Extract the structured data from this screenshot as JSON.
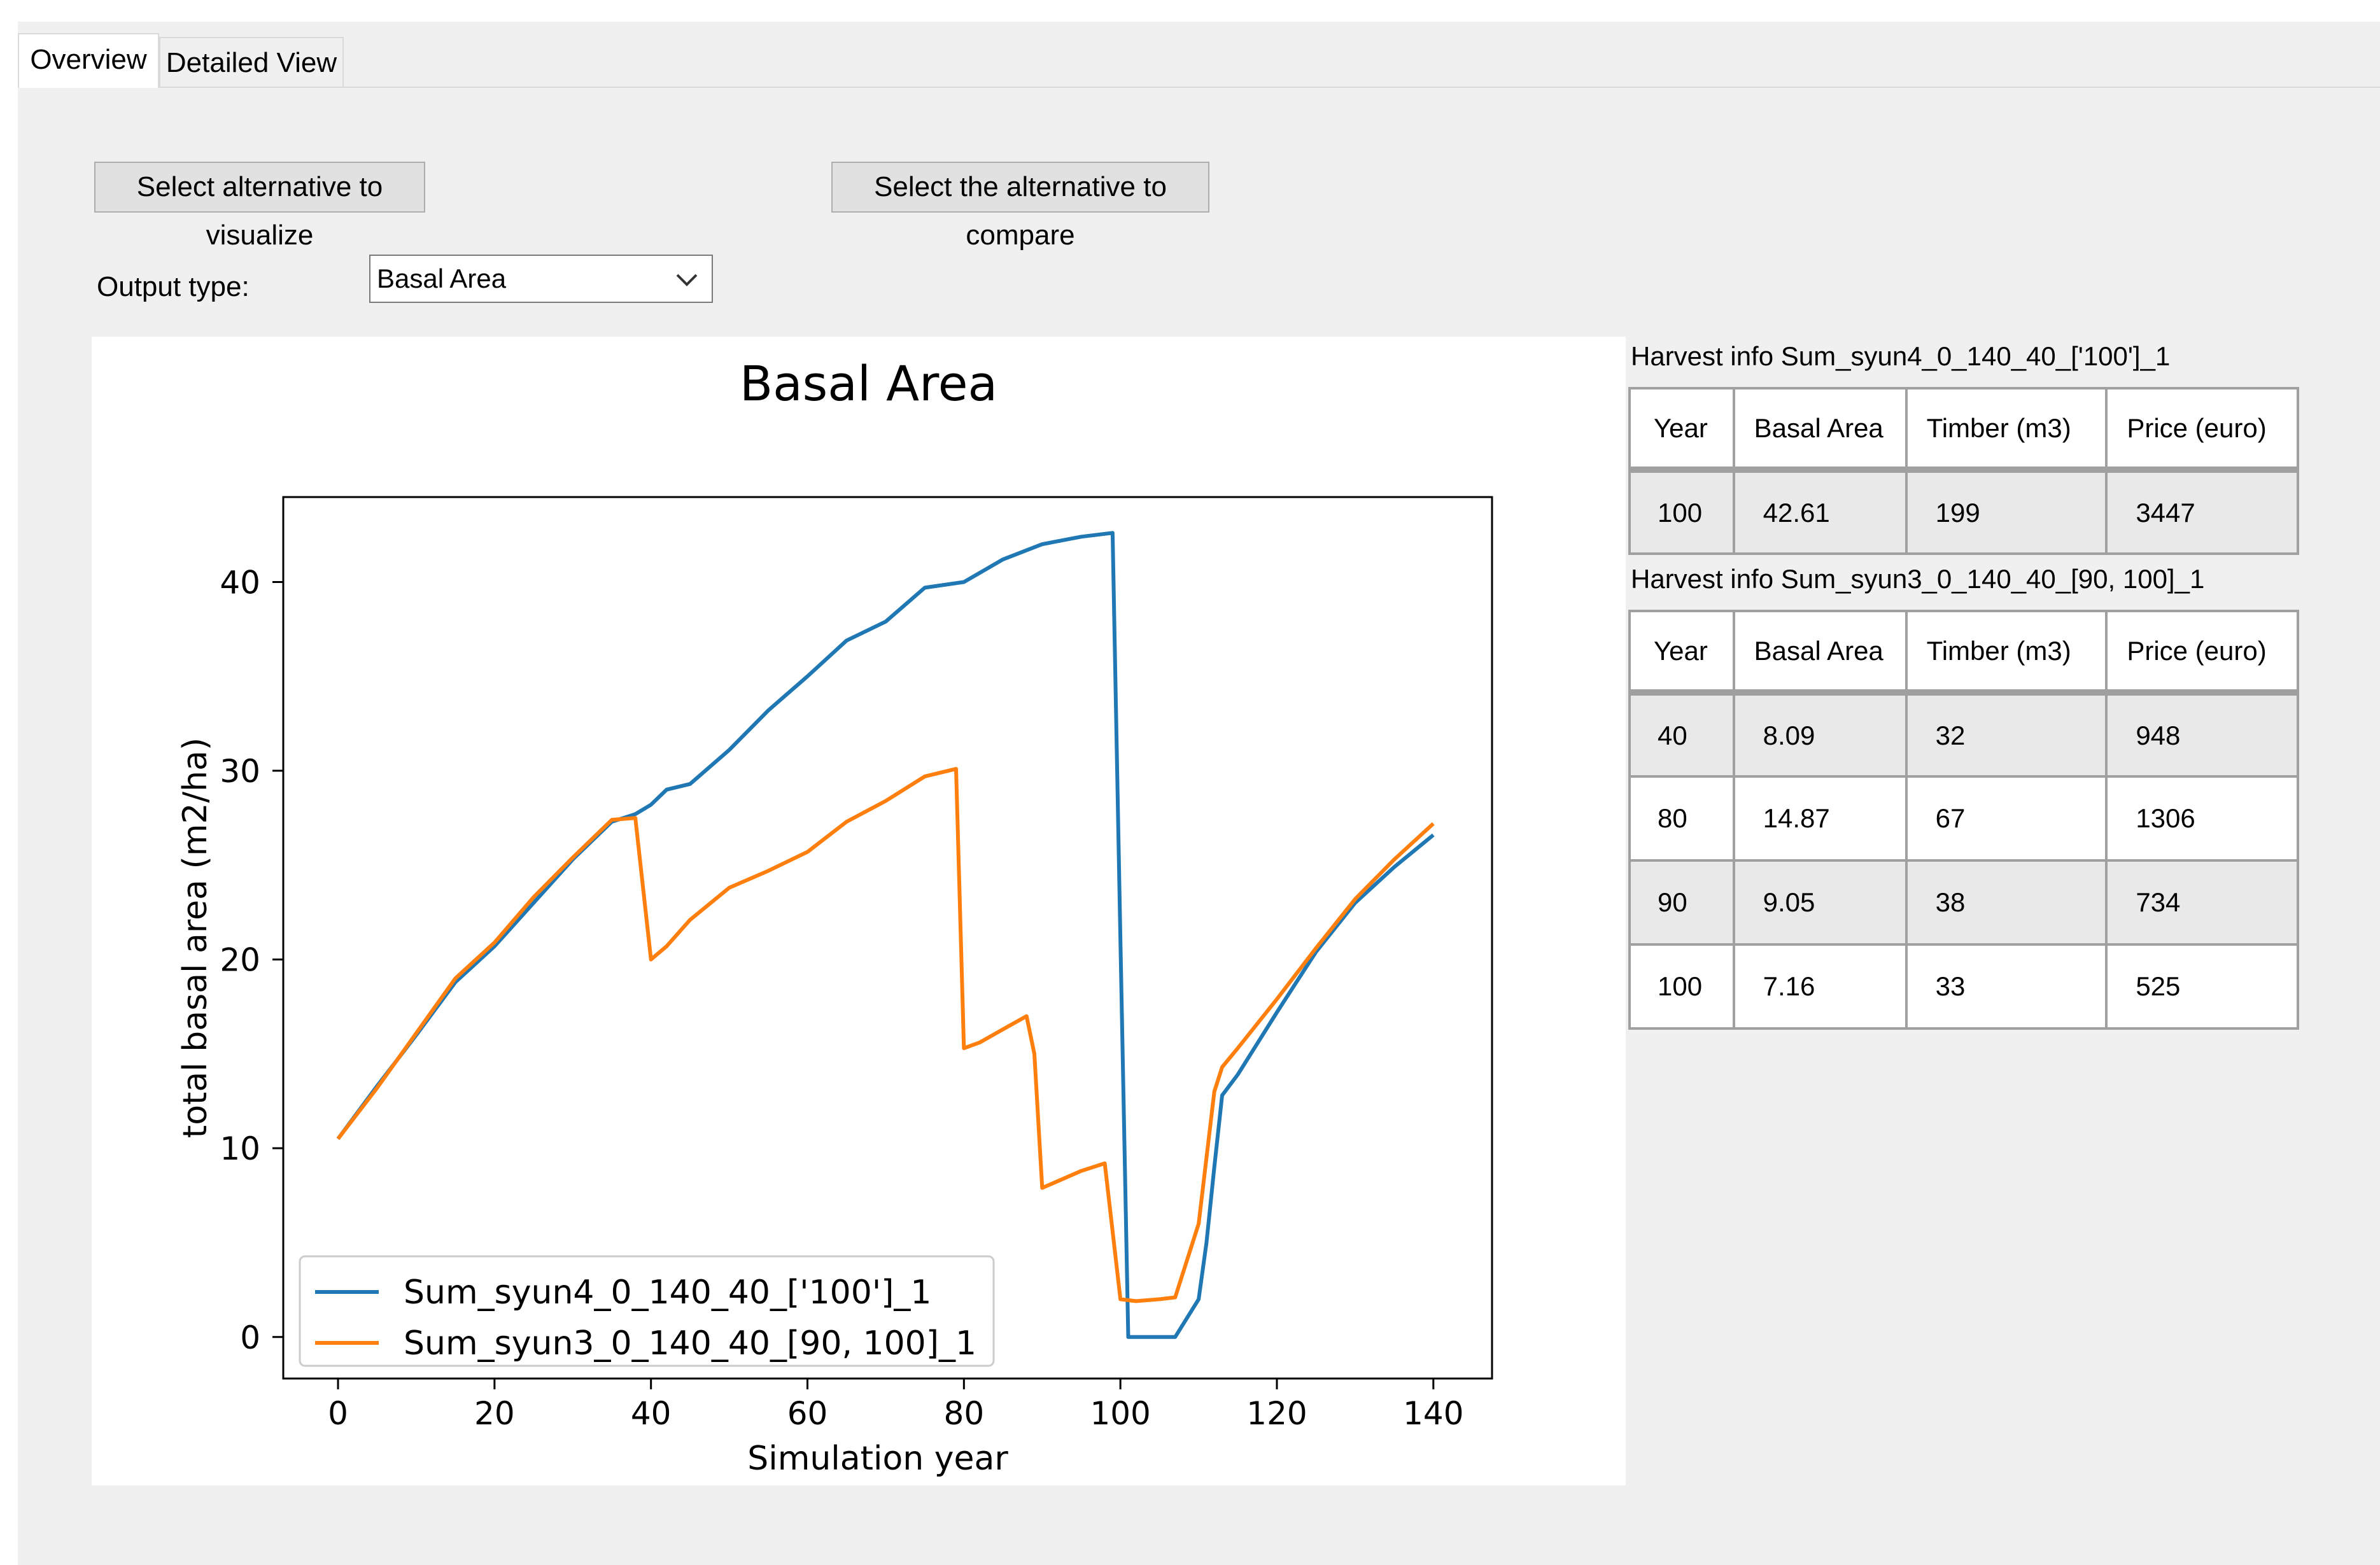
{
  "tabs": [
    {
      "label": "Overview",
      "active": true
    },
    {
      "label": "Detailed View",
      "active": false
    }
  ],
  "controls": {
    "select_alt_button": "Select alternative to visualize",
    "compare_alt_button": "Select the alternative to compare",
    "output_type_label": "Output type:",
    "output_type_value": "Basal Area"
  },
  "harvest_tables": [
    {
      "caption": "Harvest info Sum_syun4_0_140_40_['100']_1",
      "headers": [
        "Year",
        "Basal Area",
        "Timber (m3)",
        "Price (euro)"
      ],
      "rows": [
        [
          "100",
          "42.61",
          "199",
          "3447"
        ]
      ]
    },
    {
      "caption": "Harvest info Sum_syun3_0_140_40_[90, 100]_1",
      "headers": [
        "Year",
        "Basal Area",
        "Timber (m3)",
        "Price (euro)"
      ],
      "rows": [
        [
          "40",
          "8.09",
          "32",
          "948"
        ],
        [
          "80",
          "14.87",
          "67",
          "1306"
        ],
        [
          "90",
          "9.05",
          "38",
          "734"
        ],
        [
          "100",
          "7.16",
          "33",
          "525"
        ]
      ]
    }
  ],
  "chart_data": {
    "type": "line",
    "title": "Basal Area",
    "xlabel": "Simulation year",
    "ylabel": "total basal area (m2/ha)",
    "xlim": [
      -7,
      147.5
    ],
    "ylim": [
      -2.2,
      44.5
    ],
    "xticks": [
      0,
      20,
      40,
      60,
      80,
      100,
      120,
      140
    ],
    "yticks": [
      0,
      10,
      20,
      30,
      40
    ],
    "legend_position": "lower-left",
    "grid": false,
    "series": [
      {
        "name": "Sum_syun4_0_140_40_['100']_1",
        "color": "#1f77b4",
        "x": [
          0,
          5,
          10,
          15,
          20,
          25,
          30,
          35,
          38,
          40,
          42,
          45,
          50,
          55,
          60,
          65,
          70,
          75,
          80,
          85,
          90,
          95,
          99,
          100,
          101,
          105,
          107,
          110,
          111,
          112,
          113,
          115,
          120,
          125,
          130,
          135,
          140
        ],
        "y": [
          10.5,
          13.3,
          16.0,
          18.8,
          20.7,
          23.0,
          25.3,
          27.3,
          27.7,
          28.2,
          29.0,
          29.3,
          31.1,
          33.2,
          35.0,
          36.9,
          37.9,
          39.7,
          40.0,
          41.2,
          42.0,
          42.4,
          42.6,
          21.0,
          0.0,
          0.0,
          0.0,
          2.0,
          5.0,
          9.0,
          12.8,
          13.9,
          17.2,
          20.4,
          23.0,
          24.9,
          26.6
        ]
      },
      {
        "name": "Sum_syun3_0_140_40_[90, 100]_1",
        "color": "#ff7f0e",
        "x": [
          0,
          5,
          10,
          15,
          20,
          25,
          30,
          35,
          38,
          40,
          42,
          45,
          50,
          55,
          60,
          65,
          70,
          75,
          79,
          80,
          82,
          85,
          88,
          89,
          90,
          95,
          98,
          100,
          102,
          105,
          107,
          110,
          111,
          112,
          113,
          115,
          120,
          125,
          130,
          135,
          140
        ],
        "y": [
          10.5,
          13.2,
          16.1,
          19.0,
          20.9,
          23.3,
          25.4,
          27.4,
          27.5,
          20.0,
          20.7,
          22.1,
          23.8,
          24.7,
          25.7,
          27.3,
          28.4,
          29.7,
          30.1,
          15.3,
          15.6,
          16.3,
          17.0,
          15.0,
          7.9,
          8.8,
          9.2,
          2.0,
          1.9,
          2.0,
          2.1,
          6.0,
          9.5,
          13.0,
          14.3,
          15.3,
          17.9,
          20.6,
          23.2,
          25.3,
          27.2
        ]
      }
    ]
  }
}
